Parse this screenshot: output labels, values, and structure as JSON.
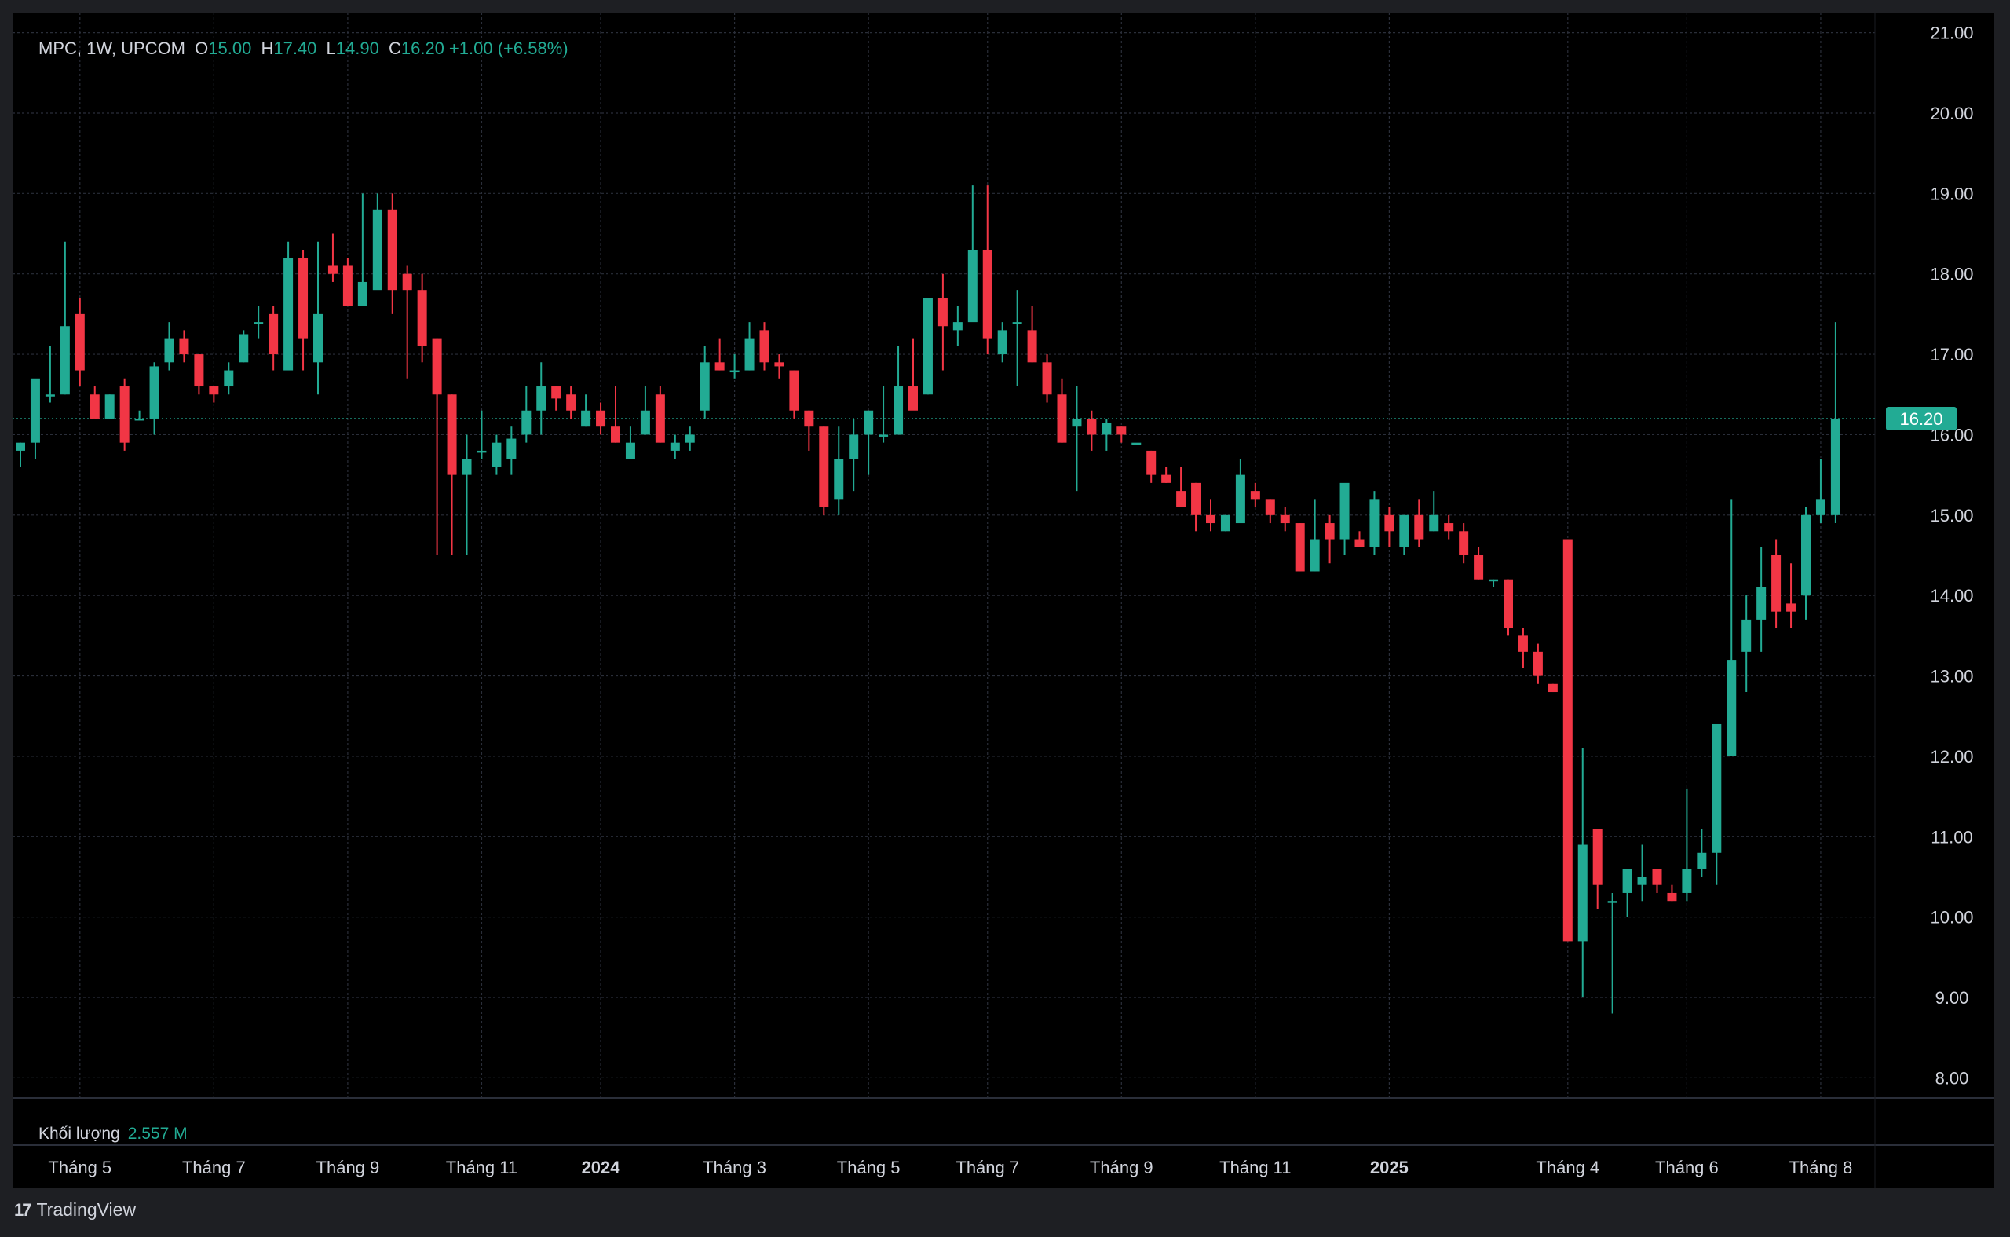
{
  "legend": {
    "symbol": "MPC, 1W, UPCOM",
    "open_label": "O",
    "open": "15.00",
    "high_label": "H",
    "high": "17.40",
    "low_label": "L",
    "low": "14.90",
    "close_label": "C",
    "close": "16.20",
    "change": "+1.00 (+6.58%)"
  },
  "volume_legend": {
    "label": "Khối lượng",
    "value": "2.557 M"
  },
  "price_badge": "16.20",
  "brand": "TradingView",
  "colors": {
    "up": "#22ab94",
    "down": "#f23645",
    "background": "#000000",
    "grid": "#2a2e39",
    "text": "#d1d4dc"
  },
  "chart_data": {
    "type": "candlestick",
    "title": "MPC, 1W, UPCOM",
    "y_ticks": [
      "8.00",
      "9.00",
      "10.00",
      "11.00",
      "12.00",
      "13.00",
      "14.00",
      "15.00",
      "16.00",
      "17.00",
      "18.00",
      "19.00",
      "20.00",
      "21.00"
    ],
    "ylim": [
      7.75,
      21.25
    ],
    "x_labels": [
      {
        "label": "Tháng 5",
        "index": 4,
        "bold": false
      },
      {
        "label": "Tháng 7",
        "index": 13,
        "bold": false
      },
      {
        "label": "Tháng 9",
        "index": 22,
        "bold": false
      },
      {
        "label": "Tháng 11",
        "index": 31,
        "bold": false
      },
      {
        "label": "2024",
        "index": 39,
        "bold": true
      },
      {
        "label": "Tháng 3",
        "index": 48,
        "bold": false
      },
      {
        "label": "Tháng 5",
        "index": 57,
        "bold": false
      },
      {
        "label": "Tháng 7",
        "index": 65,
        "bold": false
      },
      {
        "label": "Tháng 9",
        "index": 74,
        "bold": false
      },
      {
        "label": "Tháng 11",
        "index": 83,
        "bold": false
      },
      {
        "label": "2025",
        "index": 92,
        "bold": true
      },
      {
        "label": "Tháng 4",
        "index": 104,
        "bold": false
      },
      {
        "label": "Tháng 6",
        "index": 112,
        "bold": false
      },
      {
        "label": "Tháng 8",
        "index": 121,
        "bold": false
      }
    ],
    "last_close": 16.2,
    "grid": true,
    "ohlc": [
      [
        15.8,
        15.9,
        15.6,
        15.9
      ],
      [
        15.9,
        16.3,
        15.7,
        16.7
      ],
      [
        16.5,
        17.1,
        16.4,
        16.5
      ],
      [
        16.5,
        18.4,
        16.5,
        17.35
      ],
      [
        17.5,
        17.7,
        16.6,
        16.8
      ],
      [
        16.5,
        16.6,
        16.3,
        16.2
      ],
      [
        16.2,
        16.5,
        16.2,
        16.5
      ],
      [
        16.6,
        16.7,
        15.8,
        15.9
      ],
      [
        16.2,
        16.3,
        16.2,
        16.2
      ],
      [
        16.2,
        16.9,
        16.0,
        16.85
      ],
      [
        16.9,
        17.4,
        16.8,
        17.2
      ],
      [
        17.2,
        17.3,
        16.9,
        17.0
      ],
      [
        17.0,
        17.0,
        16.5,
        16.6
      ],
      [
        16.6,
        16.6,
        16.4,
        16.5
      ],
      [
        16.6,
        16.9,
        16.5,
        16.8
      ],
      [
        16.9,
        17.3,
        16.9,
        17.25
      ],
      [
        17.4,
        17.6,
        17.2,
        17.4
      ],
      [
        17.5,
        17.6,
        16.8,
        17.0
      ],
      [
        16.8,
        18.4,
        16.9,
        18.2
      ],
      [
        18.2,
        18.3,
        16.8,
        17.2
      ],
      [
        16.9,
        18.4,
        16.5,
        17.5
      ],
      [
        18.1,
        18.5,
        17.9,
        18.0
      ],
      [
        18.1,
        18.2,
        17.6,
        17.6
      ],
      [
        17.6,
        19.0,
        17.6,
        17.9
      ],
      [
        17.8,
        19.0,
        18.0,
        18.8
      ],
      [
        18.8,
        19.0,
        17.5,
        17.8
      ],
      [
        18.0,
        18.1,
        16.7,
        17.8
      ],
      [
        17.8,
        18.0,
        16.9,
        17.1
      ],
      [
        17.2,
        17.2,
        14.5,
        16.5
      ],
      [
        16.5,
        16.5,
        14.5,
        15.5
      ],
      [
        15.5,
        16.0,
        14.5,
        15.7
      ],
      [
        15.8,
        16.3,
        15.7,
        15.8
      ],
      [
        15.6,
        16.0,
        15.5,
        15.9
      ],
      [
        15.7,
        16.1,
        15.5,
        15.95
      ],
      [
        16.0,
        16.6,
        15.9,
        16.3
      ],
      [
        16.3,
        16.9,
        16.0,
        16.6
      ],
      [
        16.6,
        16.6,
        16.3,
        16.45
      ],
      [
        16.5,
        16.6,
        16.2,
        16.3
      ],
      [
        16.1,
        16.5,
        16.1,
        16.3
      ],
      [
        16.3,
        16.4,
        16.0,
        16.1
      ],
      [
        16.1,
        16.6,
        15.9,
        15.9
      ],
      [
        15.7,
        16.1,
        15.7,
        15.9
      ],
      [
        16.0,
        16.6,
        16.0,
        16.3
      ],
      [
        16.5,
        16.6,
        15.9,
        15.9
      ],
      [
        15.8,
        16.0,
        15.7,
        15.9
      ],
      [
        15.9,
        16.1,
        15.8,
        16.0
      ],
      [
        16.3,
        17.1,
        16.2,
        16.9
      ],
      [
        16.9,
        17.2,
        16.8,
        16.8
      ],
      [
        16.8,
        17.0,
        16.7,
        16.8
      ],
      [
        16.8,
        17.4,
        16.8,
        17.2
      ],
      [
        17.3,
        17.4,
        16.8,
        16.9
      ],
      [
        16.9,
        17.0,
        16.7,
        16.85
      ],
      [
        16.8,
        16.8,
        16.2,
        16.3
      ],
      [
        16.3,
        16.3,
        15.8,
        16.1
      ],
      [
        16.1,
        16.1,
        15.0,
        15.1
      ],
      [
        15.2,
        16.1,
        15.0,
        15.7
      ],
      [
        15.7,
        16.2,
        15.3,
        16.0
      ],
      [
        16.0,
        16.3,
        15.5,
        16.3
      ],
      [
        16.0,
        16.6,
        15.9,
        16.0
      ],
      [
        16.0,
        17.1,
        16.0,
        16.6
      ],
      [
        16.6,
        17.2,
        16.5,
        16.3
      ],
      [
        16.5,
        17.0,
        16.5,
        17.7
      ],
      [
        17.7,
        18.0,
        16.8,
        17.35
      ],
      [
        17.3,
        17.6,
        17.1,
        17.4
      ],
      [
        17.4,
        19.1,
        17.6,
        18.3
      ],
      [
        18.3,
        19.1,
        17.0,
        17.2
      ],
      [
        17.0,
        17.4,
        16.9,
        17.3
      ],
      [
        17.4,
        17.8,
        16.6,
        17.4
      ],
      [
        17.3,
        17.6,
        16.9,
        16.9
      ],
      [
        16.9,
        17.0,
        16.4,
        16.5
      ],
      [
        16.5,
        16.7,
        15.9,
        15.9
      ],
      [
        16.1,
        16.6,
        15.3,
        16.2
      ],
      [
        16.2,
        16.3,
        15.8,
        16.0
      ],
      [
        16.0,
        16.2,
        15.8,
        16.15
      ],
      [
        16.1,
        16.1,
        15.9,
        16.0
      ],
      [
        15.9,
        15.9,
        15.9,
        15.9
      ],
      [
        15.8,
        15.8,
        15.4,
        15.5
      ],
      [
        15.5,
        15.6,
        15.4,
        15.4
      ],
      [
        15.3,
        15.6,
        15.2,
        15.1
      ],
      [
        15.4,
        15.4,
        14.8,
        15.0
      ],
      [
        15.0,
        15.2,
        14.8,
        14.9
      ],
      [
        14.8,
        15.0,
        14.8,
        15.0
      ],
      [
        14.9,
        15.7,
        14.9,
        15.5
      ],
      [
        15.3,
        15.4,
        15.1,
        15.2
      ],
      [
        15.2,
        15.2,
        14.9,
        15.0
      ],
      [
        15.0,
        15.1,
        14.8,
        14.9
      ],
      [
        14.9,
        14.9,
        14.3,
        14.3
      ],
      [
        14.3,
        15.2,
        14.3,
        14.7
      ],
      [
        14.9,
        15.0,
        14.4,
        14.7
      ],
      [
        14.7,
        15.3,
        14.5,
        15.4
      ],
      [
        14.7,
        14.8,
        14.6,
        14.6
      ],
      [
        14.6,
        15.3,
        14.5,
        15.2
      ],
      [
        15.0,
        15.1,
        14.6,
        14.8
      ],
      [
        14.6,
        15.0,
        14.5,
        15.0
      ],
      [
        15.0,
        15.2,
        14.6,
        14.7
      ],
      [
        14.8,
        15.3,
        14.8,
        15.0
      ],
      [
        14.9,
        15.0,
        14.7,
        14.8
      ],
      [
        14.8,
        14.9,
        14.4,
        14.5
      ],
      [
        14.5,
        14.6,
        14.2,
        14.2
      ],
      [
        14.2,
        14.2,
        14.1,
        14.2
      ],
      [
        14.2,
        14.2,
        13.5,
        13.6
      ],
      [
        13.5,
        13.6,
        13.1,
        13.3
      ],
      [
        13.3,
        13.4,
        12.9,
        13.0
      ],
      [
        12.9,
        12.9,
        12.8,
        12.8
      ],
      [
        14.7,
        14.7,
        9.7,
        9.7
      ],
      [
        9.7,
        12.1,
        9.0,
        10.9
      ],
      [
        11.1,
        11.1,
        10.1,
        10.4
      ],
      [
        10.2,
        10.3,
        8.8,
        10.2
      ],
      [
        10.3,
        10.6,
        10.0,
        10.6
      ],
      [
        10.4,
        10.9,
        10.2,
        10.5
      ],
      [
        10.6,
        10.6,
        10.3,
        10.4
      ],
      [
        10.3,
        10.4,
        10.2,
        10.2
      ],
      [
        10.3,
        11.6,
        10.2,
        10.6
      ],
      [
        10.6,
        11.1,
        10.5,
        10.8
      ],
      [
        10.8,
        12.0,
        10.4,
        12.4
      ],
      [
        12.0,
        15.2,
        12.0,
        13.2
      ],
      [
        13.3,
        14.0,
        12.8,
        13.7
      ],
      [
        13.7,
        14.6,
        13.3,
        14.1
      ],
      [
        14.5,
        14.7,
        13.6,
        13.8
      ],
      [
        13.9,
        14.4,
        13.6,
        13.8
      ],
      [
        14.0,
        15.1,
        13.7,
        15.0
      ],
      [
        15.0,
        15.7,
        14.9,
        15.2
      ],
      [
        15.0,
        17.4,
        14.9,
        16.2
      ]
    ]
  }
}
